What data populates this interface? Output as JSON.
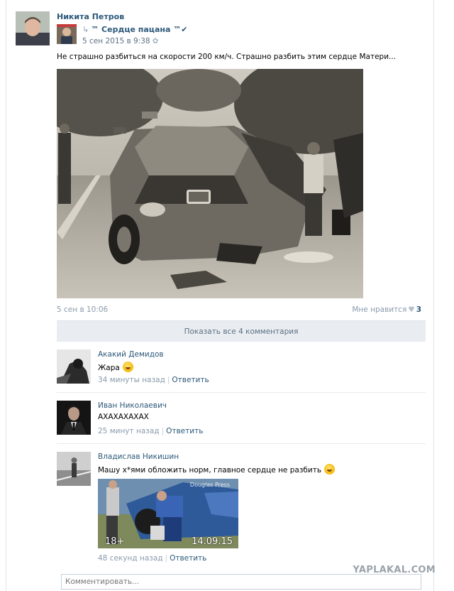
{
  "post": {
    "author_name": "Никита Петров",
    "repost_icon": "share-icon",
    "repost_group": "™ Сердце пацана ™✔",
    "repost_date": "5 сен 2015 в 9:38",
    "text": "Не страшно разбиться на скорости 200 км/ч. Страшно разбить этим сердце Матери...",
    "date": "5 сен в 10:06",
    "like_label": "Мне нравится",
    "like_count": "3"
  },
  "show_all_comments": "Показать все 4 комментария",
  "comments": [
    {
      "author": "Акакий Демидов",
      "text": "Жара",
      "emoji": "laughing-emoji",
      "time": "34 минуты назад",
      "reply": "Ответить"
    },
    {
      "author": "Иван Николаевич",
      "text": "АХАХАХАХАХ",
      "time": "25 минут назад",
      "reply": "Ответить"
    },
    {
      "author": "Владислав Никишин",
      "text": "Машу х*ями обложить норм, главное сердце не разбить",
      "emoji": "laughing-emoji",
      "photo_tag_left": "18+",
      "photo_tag_right": "14.09.15",
      "photo_watermark": "Douglas Press",
      "time": "48 секунд назад",
      "reply": "Ответить"
    }
  ],
  "compose_placeholder": "Комментировать...",
  "watermark": "YAPLAKAL.COM"
}
